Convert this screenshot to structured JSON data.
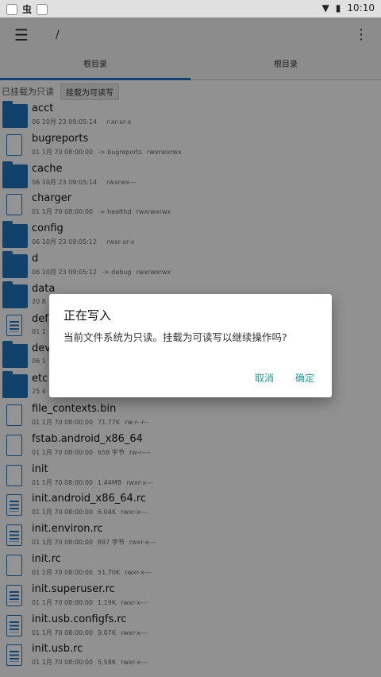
{
  "statusbar": {
    "app_glyph": "虫",
    "time": "10:10"
  },
  "toolbar": {
    "path": "/"
  },
  "tabs": [
    {
      "label": "根目录"
    },
    {
      "label": "根目录"
    }
  ],
  "mount": {
    "readonly_label": "已挂载为只读",
    "button_label": "挂载为可读写"
  },
  "files": [
    {
      "name": "acct",
      "date": "06 10月 23 09:05:14",
      "extra": "",
      "perm": "r-xr-xr-x",
      "type": "folder"
    },
    {
      "name": "bugreports",
      "date": "01 1月 70 08:00:00",
      "extra": "-> bugreports",
      "perm": "rwxrwxrwx",
      "type": "file"
    },
    {
      "name": "cache",
      "date": "06 10月 23 09:05:14",
      "extra": "",
      "perm": "rwxrwx---",
      "type": "folder"
    },
    {
      "name": "charger",
      "date": "01 1月 70 08:00:00",
      "extra": "-> healthd",
      "perm": "rwxrwxrwx",
      "type": "file"
    },
    {
      "name": "config",
      "date": "06 10月 23 09:05:12",
      "extra": "",
      "perm": "rwxr-xr-x",
      "type": "folder"
    },
    {
      "name": "d",
      "date": "06 10月 23 09:05:12",
      "extra": "-> debug",
      "perm": "rwxrwxrwx",
      "type": "folder"
    },
    {
      "name": "data",
      "date": "20 8",
      "extra": "",
      "perm": "",
      "type": "folder"
    },
    {
      "name": "def",
      "date": "01 1",
      "extra": "",
      "perm": "",
      "type": "doc"
    },
    {
      "name": "dev",
      "date": "06 1",
      "extra": "",
      "perm": "",
      "type": "folder"
    },
    {
      "name": "etc",
      "date": "25 4",
      "extra": "",
      "perm": "",
      "type": "folder"
    },
    {
      "name": "file_contexts.bin",
      "date": "01 1月 70 08:00:00",
      "extra": "71.77K",
      "perm": "rw-r--r--",
      "type": "file"
    },
    {
      "name": "fstab.android_x86_64",
      "date": "01 1月 70 08:00:00",
      "extra": "658 字节",
      "perm": "rw-r----",
      "type": "file"
    },
    {
      "name": "init",
      "date": "01 1月 70 08:00:00",
      "extra": "1.44MB",
      "perm": "rwxr-x---",
      "type": "file"
    },
    {
      "name": "init.android_x86_64.rc",
      "date": "01 1月 70 08:00:00",
      "extra": "6.04K",
      "perm": "rwxr-x---",
      "type": "doc"
    },
    {
      "name": "init.environ.rc",
      "date": "01 1月 70 08:00:00",
      "extra": "887 字节",
      "perm": "rwxr-x---",
      "type": "doc"
    },
    {
      "name": "init.rc",
      "date": "01 1月 70 08:00:00",
      "extra": "51.70K",
      "perm": "rwxr-x---",
      "type": "file"
    },
    {
      "name": "init.superuser.rc",
      "date": "01 1月 70 08:00:00",
      "extra": "1.19K",
      "perm": "rwxr-x---",
      "type": "doc"
    },
    {
      "name": "init.usb.configfs.rc",
      "date": "01 1月 70 08:00:00",
      "extra": "9.07K",
      "perm": "rwxr-x---",
      "type": "doc"
    },
    {
      "name": "init.usb.rc",
      "date": "01 1月 70 08:00:00",
      "extra": "5.58K",
      "perm": "rwxr-x---",
      "type": "doc"
    }
  ],
  "dialog": {
    "title": "正在写入",
    "message": "当前文件系统为只读。挂载为可读写以继续操作吗?",
    "cancel": "取消",
    "ok": "确定"
  }
}
